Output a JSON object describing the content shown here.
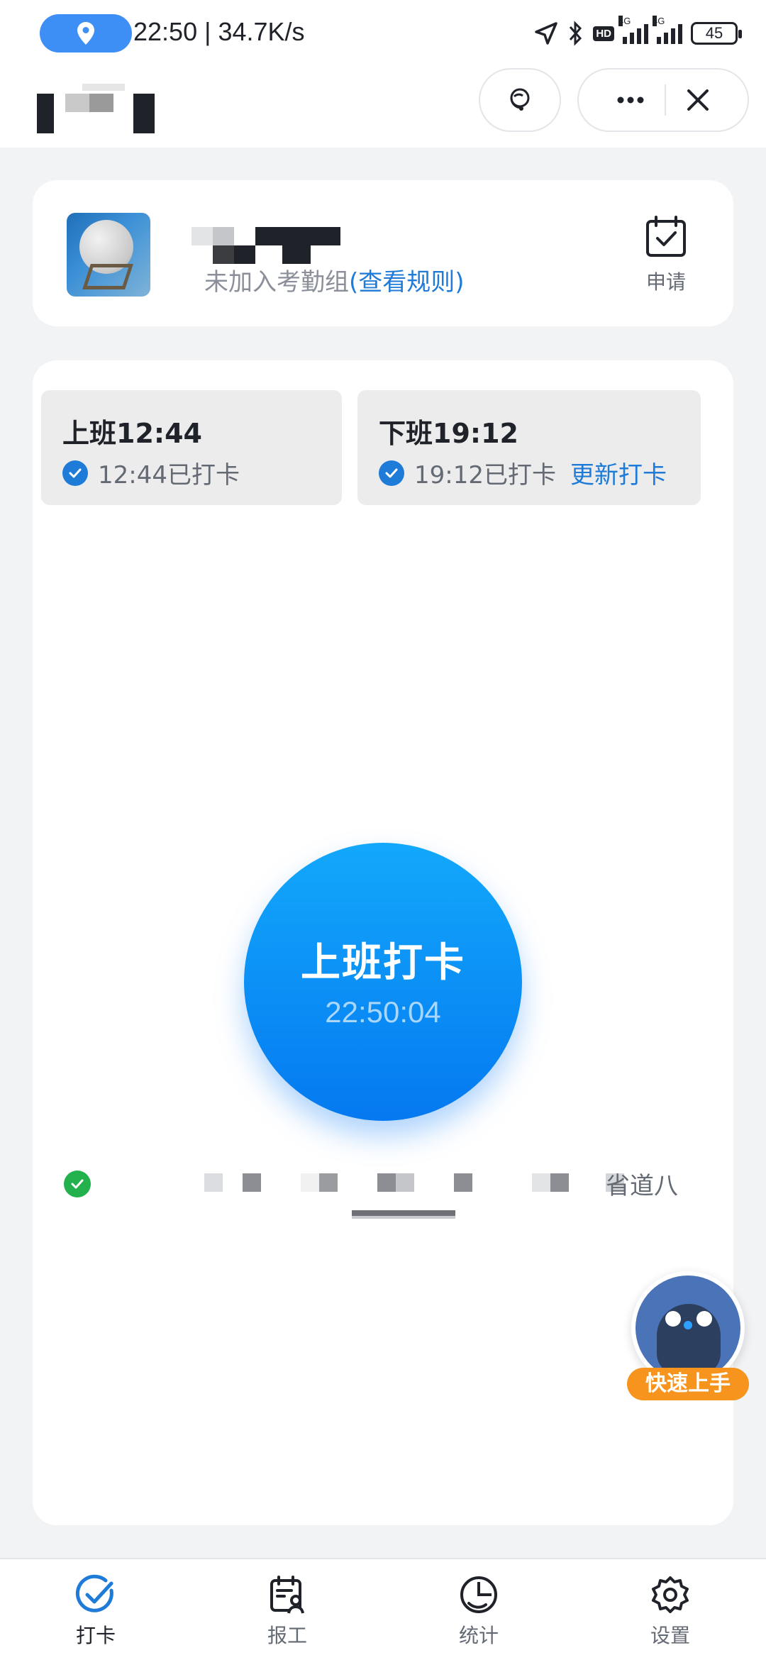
{
  "status_bar": {
    "time_speed": "22:50 | 34.7K/s",
    "network_tag_1": "4G",
    "network_tag_2": "4G",
    "hd": "HD",
    "battery": "45"
  },
  "profile": {
    "group_status": "未加入考勤组",
    "rules_link": "(查看规则)",
    "apply_label": "申请"
  },
  "shifts": [
    {
      "title": "上班12:44",
      "status": "12:44已打卡"
    },
    {
      "title": "下班19:12",
      "status": "19:12已打卡",
      "update_link": "更新打卡"
    }
  ],
  "punch": {
    "label": "上班打卡",
    "time": "22:50:04"
  },
  "location": {
    "address_tail": "省道八"
  },
  "helper": {
    "tag": "快速上手"
  },
  "nav": {
    "items": [
      {
        "label": "打卡",
        "icon": "check-icon",
        "active": true
      },
      {
        "label": "报工",
        "icon": "calendar-person-icon",
        "active": false
      },
      {
        "label": "统计",
        "icon": "pie-chart-icon",
        "active": false
      },
      {
        "label": "设置",
        "icon": "gear-icon",
        "active": false
      }
    ]
  },
  "colors": {
    "accent": "#1f7bd8",
    "punch_gradient_top": "#13a8fb",
    "punch_gradient_bottom": "#0579f0",
    "success": "#22b14c",
    "helper_tag": "#f7941d"
  }
}
